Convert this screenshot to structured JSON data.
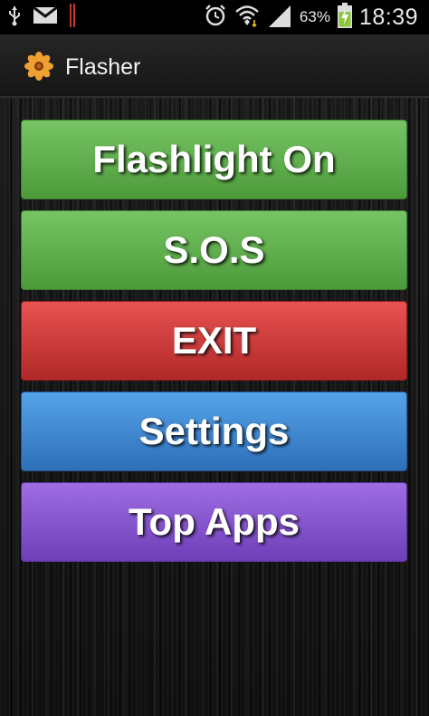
{
  "status_bar": {
    "battery_percent": "63%",
    "time": "18:39",
    "icons": [
      "usb-icon",
      "gmail-icon",
      "notification-bar-icon",
      "alarm-icon",
      "wifi-icon",
      "signal-icon",
      "battery-charging-icon"
    ]
  },
  "action_bar": {
    "title": "Flasher",
    "icon": "flower-icon"
  },
  "buttons": {
    "flashlight_on": "Flashlight On",
    "sos": "S.O.S",
    "exit": "EXIT",
    "settings": "Settings",
    "top_apps": "Top Apps"
  },
  "colors": {
    "green": "#5faf4c",
    "red": "#d03c3c",
    "blue": "#3f87d3",
    "purple": "#8655cf"
  }
}
